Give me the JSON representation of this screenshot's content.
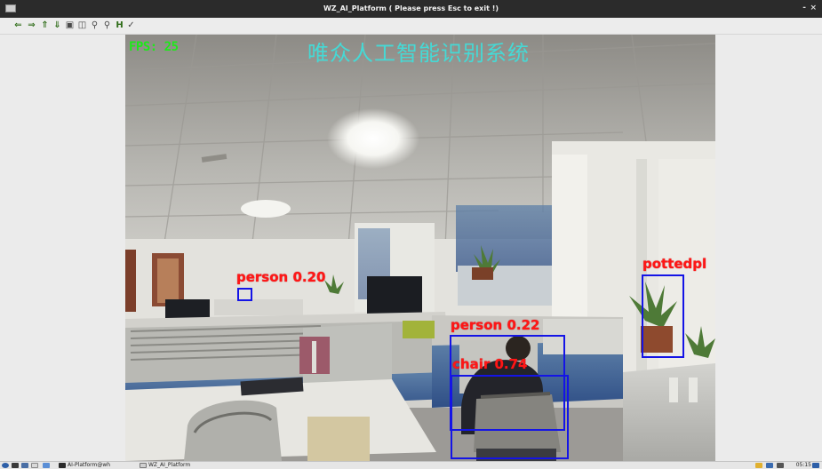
{
  "window": {
    "title": "WZ_AI_Platform ( Please press Esc to exit !)",
    "controls": [
      "-",
      "×"
    ]
  },
  "toolbar": {
    "buttons": [
      {
        "icon": "arrow-left-icon",
        "glyph": "⇐"
      },
      {
        "icon": "arrow-right-icon",
        "glyph": "⇒"
      },
      {
        "icon": "arrow-up-icon",
        "glyph": "⇑"
      },
      {
        "icon": "arrow-down-icon",
        "glyph": "⇓"
      },
      {
        "icon": "save-icon",
        "glyph": "▣"
      },
      {
        "icon": "subplots-icon",
        "glyph": "◫"
      },
      {
        "icon": "zoom-in-icon",
        "glyph": "⚲"
      },
      {
        "icon": "zoom-out-icon",
        "glyph": "⚲"
      },
      {
        "icon": "home-icon",
        "glyph": "H"
      },
      {
        "icon": "edit-icon",
        "glyph": "✓"
      }
    ]
  },
  "video": {
    "fps_text": "FPS: 25",
    "overlay_title": "唯众人工智能识别系统",
    "detections": [
      {
        "label": "person 0.20",
        "class": "person",
        "score": 0.2
      },
      {
        "label": "pottedpl",
        "class": "pottedplant",
        "score": null
      },
      {
        "label": "person 0.22",
        "class": "person",
        "score": 0.22
      },
      {
        "label": "chair 0.74",
        "class": "chair",
        "score": 0.74
      }
    ],
    "box_color": "#1414e6",
    "label_color": "#ff1616"
  },
  "taskbar": {
    "tasks": [
      "AI-Platform@wh",
      "WZ_AI_Platform"
    ],
    "clock": "05:15"
  }
}
